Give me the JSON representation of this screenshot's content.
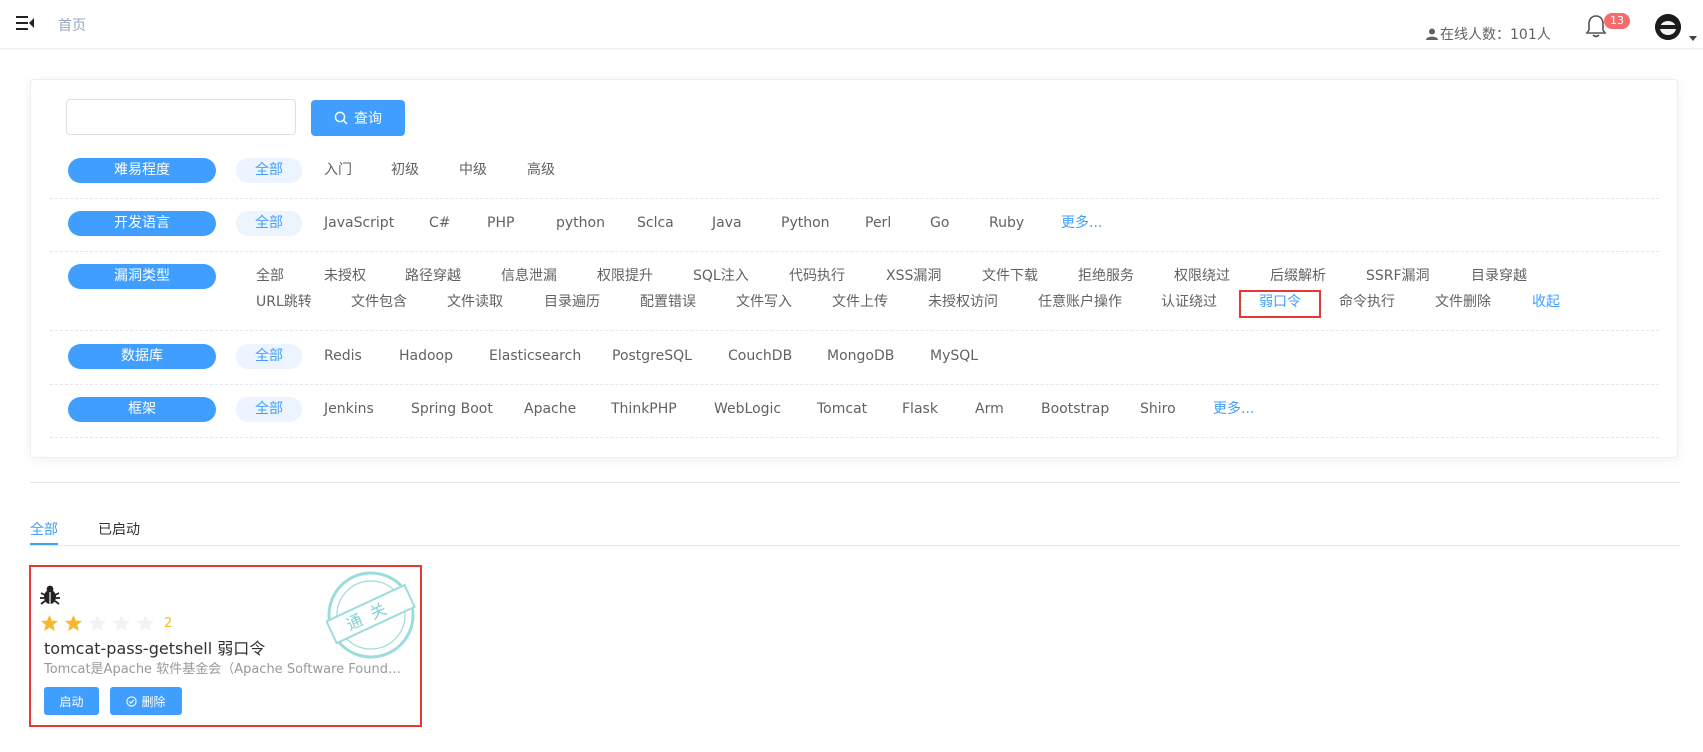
{
  "header": {
    "home": "首页",
    "online_label": "在线人数：101人",
    "notification_count": "13"
  },
  "search": {
    "value": "",
    "placeholder": "",
    "button": "查询"
  },
  "filters": {
    "difficulty": {
      "label": "难易程度",
      "options": [
        "全部",
        "入门",
        "初级",
        "中级",
        "高级"
      ]
    },
    "language": {
      "label": "开发语言",
      "options": [
        "全部",
        "JavaScript",
        "C#",
        "PHP",
        "python",
        "Sclca",
        "Java",
        "Python",
        "Perl",
        "Go",
        "Ruby"
      ],
      "more": "更多..."
    },
    "vuln_type": {
      "label": "漏洞类型",
      "row1": [
        "全部",
        "未授权",
        "路径穿越",
        "信息泄漏",
        "权限提升",
        "SQL注入",
        "代码执行",
        "XSS漏洞",
        "文件下载",
        "拒绝服务",
        "权限绕过",
        "后缀解析",
        "SSRF漏洞",
        "目录穿越"
      ],
      "row2": [
        "URL跳转",
        "文件包含",
        "文件读取",
        "目录遍历",
        "配置错误",
        "文件写入",
        "文件上传",
        "未授权访问",
        "任意账户操作",
        "认证绕过",
        "弱口令",
        "命令执行",
        "文件删除"
      ],
      "collapse": "收起"
    },
    "database": {
      "label": "数据库",
      "options": [
        "全部",
        "Redis",
        "Hadoop",
        "Elasticsearch",
        "PostgreSQL",
        "CouchDB",
        "MongoDB",
        "MySQL"
      ]
    },
    "framework": {
      "label": "框架",
      "options": [
        "全部",
        "Jenkins",
        "Spring Boot",
        "Apache",
        "ThinkPHP",
        "WebLogic",
        "Tomcat",
        "Flask",
        "Arm",
        "Bootstrap",
        "Shiro"
      ],
      "more": "更多..."
    }
  },
  "tabs": {
    "all": "全部",
    "started": "已启动"
  },
  "lab": {
    "rating": 2,
    "rating_text": "2",
    "title": "tomcat-pass-getshell 弱口令",
    "description": "Tomcat是Apache 软件基金会（Apache Software Foundation）的Jakarta 项目中的一个核心项目",
    "start_button": "启动",
    "delete_button": "删除",
    "stamp_text": "通关"
  },
  "colors": {
    "primary": "#409eff",
    "highlight_border": "#e53935",
    "star": "#f7ba2a",
    "badge": "#f56c6c",
    "stamp": "#7fd3d3"
  },
  "icons": {
    "menu": "menu-fold-icon",
    "bell": "bell-icon",
    "user": "user-icon",
    "search": "search-icon",
    "bug": "bug-icon",
    "delete": "circle-check-icon"
  }
}
